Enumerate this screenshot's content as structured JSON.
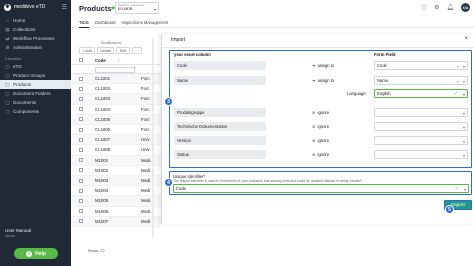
{
  "sidebar": {
    "app_name": "meddevo eTD",
    "items": [
      {
        "label": "Home",
        "icon": "home-icon",
        "glyph": "⌂"
      },
      {
        "label": "Collections",
        "icon": "collections-icon",
        "glyph": "▤"
      },
      {
        "label": "Workflow Processes",
        "icon": "workflow-icon",
        "glyph": "⇄"
      },
      {
        "label": "Administration",
        "icon": "admin-icon",
        "glyph": "⚙"
      }
    ],
    "section_label": "Favorites",
    "favorites": [
      {
        "label": "eTD",
        "icon": "folder-icon",
        "glyph": "▢"
      },
      {
        "label": "Product Groups",
        "icon": "folder-icon",
        "glyph": "▢"
      },
      {
        "label": "Products",
        "icon": "folder-icon",
        "glyph": "▢",
        "active": true
      },
      {
        "label": "Document Folders",
        "icon": "folder-icon",
        "glyph": "▢"
      },
      {
        "label": "Documents",
        "icon": "folder-icon",
        "glyph": "▢"
      },
      {
        "label": "Components",
        "icon": "folder-icon",
        "glyph": "▢"
      }
    ],
    "user_label": "User Manual",
    "user_name": "dynab",
    "help_label": "Help"
  },
  "header": {
    "title": "Products",
    "registry_label": "Regulatory Framework",
    "registry_value": "EU-MDR",
    "avatar_initials": "MA"
  },
  "tabs": [
    "Table",
    "Dashboard",
    "Inspections Management"
  ],
  "table": {
    "toolbar": {
      "add": "+ Add",
      "delete": "Delete",
      "edit": "Edit",
      "modifications": "Modifications"
    },
    "header_code": "Code",
    "rows": [
      {
        "code": "CL1001",
        "name": "Forc"
      },
      {
        "code": "CL1002",
        "name": "Forc"
      },
      {
        "code": "CL1003",
        "name": "Forc"
      },
      {
        "code": "CL1004",
        "name": "Forc"
      },
      {
        "code": "CL1005",
        "name": "Forc"
      },
      {
        "code": "CL1006",
        "name": "Forc"
      },
      {
        "code": "CL1007",
        "name": "Univ"
      },
      {
        "code": "CL1008",
        "name": "Univ"
      },
      {
        "code": "M1001",
        "name": "Medi"
      },
      {
        "code": "M1002",
        "name": "Medi"
      },
      {
        "code": "M1003",
        "name": "Medi"
      },
      {
        "code": "M1004",
        "name": "Medi"
      },
      {
        "code": "M1005",
        "name": "Medi"
      },
      {
        "code": "M1006",
        "name": "Medi"
      },
      {
        "code": "M1007",
        "name": "Medi"
      }
    ],
    "footer": "Rows: 22"
  },
  "dialog": {
    "title": "Import",
    "col_source": "your excel column",
    "col_target": "Form Field",
    "mappings": [
      {
        "source": "Code",
        "action": "assign to",
        "action_icon": "arrow-icon",
        "target": "Code"
      },
      {
        "source": "Name",
        "action": "assign to",
        "action_icon": "arrow-icon",
        "target": "Name"
      },
      {
        "source": "Produktgruppe",
        "action": "ignore",
        "action_icon": "ignore-icon",
        "target": ""
      },
      {
        "source": "Technische Dokumentation",
        "action": "ignore",
        "action_icon": "ignore-icon",
        "target": ""
      },
      {
        "source": "Version",
        "action": "ignore",
        "action_icon": "ignore-icon",
        "target": ""
      },
      {
        "source": "Status",
        "action": "ignore",
        "action_icon": "ignore-icon",
        "target": ""
      }
    ],
    "language_label": "Language:",
    "language_value": "English",
    "uid_title": "Unique Identifier*",
    "uid_desc": "The unique identifier is used to find entries in your collection that already exist and could be updated instead of newly created*",
    "uid_value": "Code",
    "import_label": "Import",
    "badges": [
      "3",
      "4",
      "5"
    ]
  },
  "colors": {
    "sidebar": "#1f2a36",
    "accent_blue": "#2e6bd1",
    "green": "#58b947",
    "teal": "#1f9a86"
  }
}
